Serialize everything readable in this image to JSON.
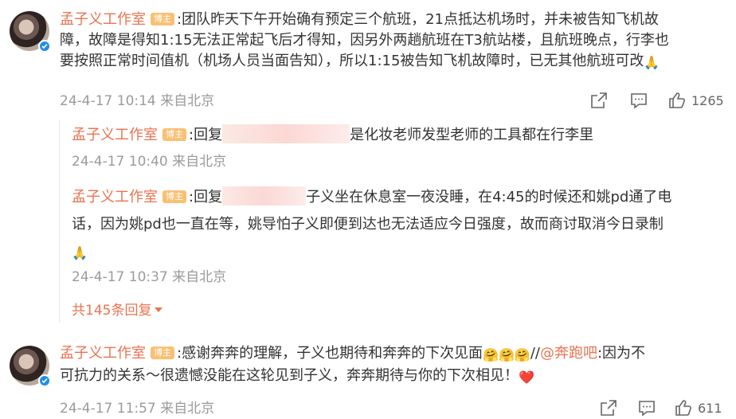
{
  "comment1": {
    "author": "孟子义工作室",
    "tag": "博主",
    "line1": ":团队昨天下午开始确有预定三个航班，21点抵达机场时，并未被告知飞机故",
    "line2": "障，故障是得知1:15无法正常起飞后才得知，因另外两趟航班在T3航站楼，且航班晚点，行李也",
    "line3": "要按照正常时间值机（机场人员当面告知），所以1:15被告知飞机故障时，已无其他航班可改",
    "emoji": "🙏",
    "timestamp": "24-4-17 10:14",
    "location": "来自北京",
    "likes": "1265"
  },
  "reply1": {
    "author": "孟子义工作室",
    "tag": "博主",
    "prefix": ":回复",
    "text": "是化妆老师发型老师的工具都在行李里",
    "timestamp": "24-4-17 10:40",
    "location": "来自北京"
  },
  "reply2": {
    "author": "孟子义工作室",
    "tag": "博主",
    "prefix": ":回复",
    "line1": "子义坐在休息室一夜没睡，在4:45的时候还和姚pd通了电",
    "line2": "话，因为姚pd也一直在等，姚导怕子义即便到达也无法适应今日强度，故而商讨取消今日录制",
    "emoji": "🙏",
    "timestamp": "24-4-17 10:37",
    "location": "来自北京"
  },
  "more_replies": "共145条回复",
  "comment2": {
    "author": "孟子义工作室",
    "tag": "博主",
    "text_a": ":感谢奔奔的理解，子义也期待和奔奔的下次见面",
    "hug_emoji": "🤗",
    "sep": "//",
    "mention": "@奔跑吧",
    "text_b": ":因为不",
    "line2": "可抗力的关系～很遗憾没能在这轮见到子义，奔奔期待与你的下次相见！",
    "heart": "❤️",
    "timestamp": "24-4-17 11:57",
    "location": "来自北京",
    "likes": "611"
  }
}
